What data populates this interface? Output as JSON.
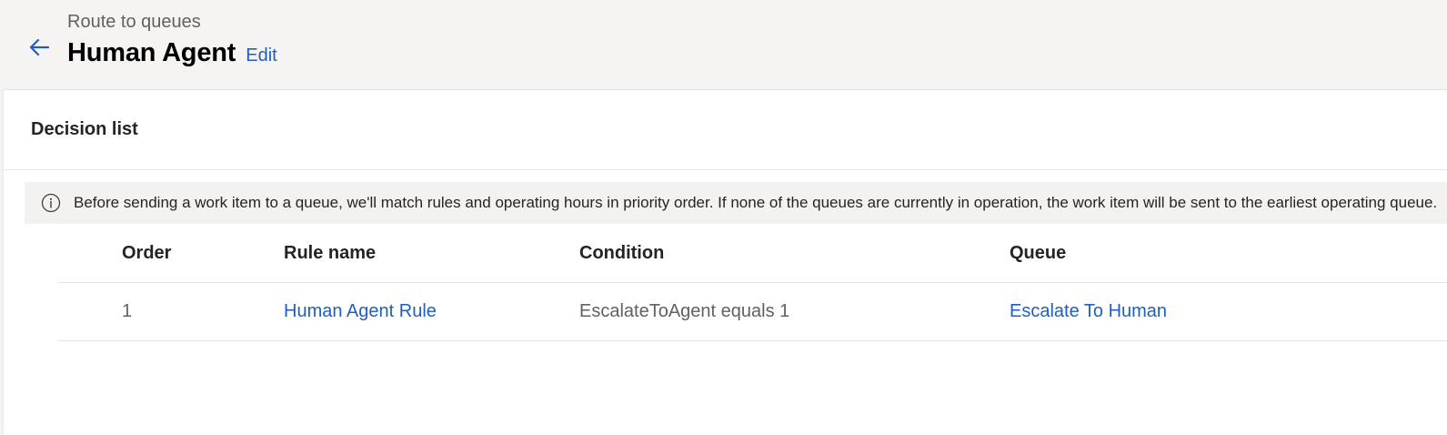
{
  "header": {
    "breadcrumb": "Route to queues",
    "title": "Human Agent",
    "edit_label": "Edit"
  },
  "icons": {
    "back": "arrow-left-icon",
    "info": "info-icon"
  },
  "colors": {
    "link": "#1f5fbf",
    "header_bg": "#f5f4f3",
    "info_bar_bg": "#f3f2f1"
  },
  "decision_list": {
    "title": "Decision list",
    "info_message": "Before sending a work item to a queue, we'll match rules and operating hours in priority order. If none of the queues are currently in operation, the work item will be sent to the earliest operating queue.",
    "columns": {
      "order": "Order",
      "rule_name": "Rule name",
      "condition": "Condition",
      "queue": "Queue"
    },
    "rows": [
      {
        "order": "1",
        "rule_name": "Human Agent Rule",
        "condition": "EscalateToAgent equals 1",
        "queue": "Escalate To Human"
      }
    ]
  }
}
